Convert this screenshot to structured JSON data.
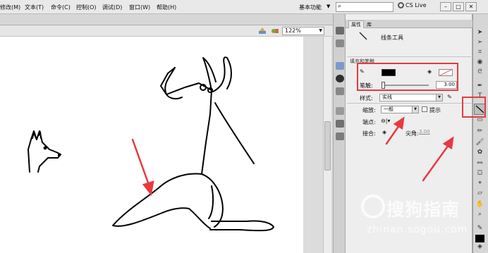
{
  "menu": {
    "items": [
      "修改(M)",
      "文本(T)",
      "命令(C)",
      "控制(O)",
      "调试(D)",
      "窗口(W)",
      "帮助(H)"
    ],
    "workspace": "基本功能",
    "cs_live": "CS Live"
  },
  "stage": {
    "zoom": "122%"
  },
  "panel": {
    "tabs": {
      "properties": "属性",
      "library": "库"
    },
    "tool_name": "线条工具",
    "section_fill_stroke": "填充和笔触",
    "stroke_label": "笔触:",
    "stroke_value": "3.00",
    "style_label": "样式:",
    "style_value": "实线",
    "scale_label": "缩放:",
    "scale_value": "一般",
    "hint_label": "提示",
    "cap_label": "端点:",
    "join_label": "接合:",
    "miter_label": "尖角:",
    "miter_value": "3.00"
  },
  "watermark": {
    "text": "搜狗指南",
    "sub": "zhinan.sogou.com"
  },
  "colors": {
    "stroke_color": "#000000",
    "annotation_red": "#e8393f",
    "canvas": "#ffffff"
  }
}
